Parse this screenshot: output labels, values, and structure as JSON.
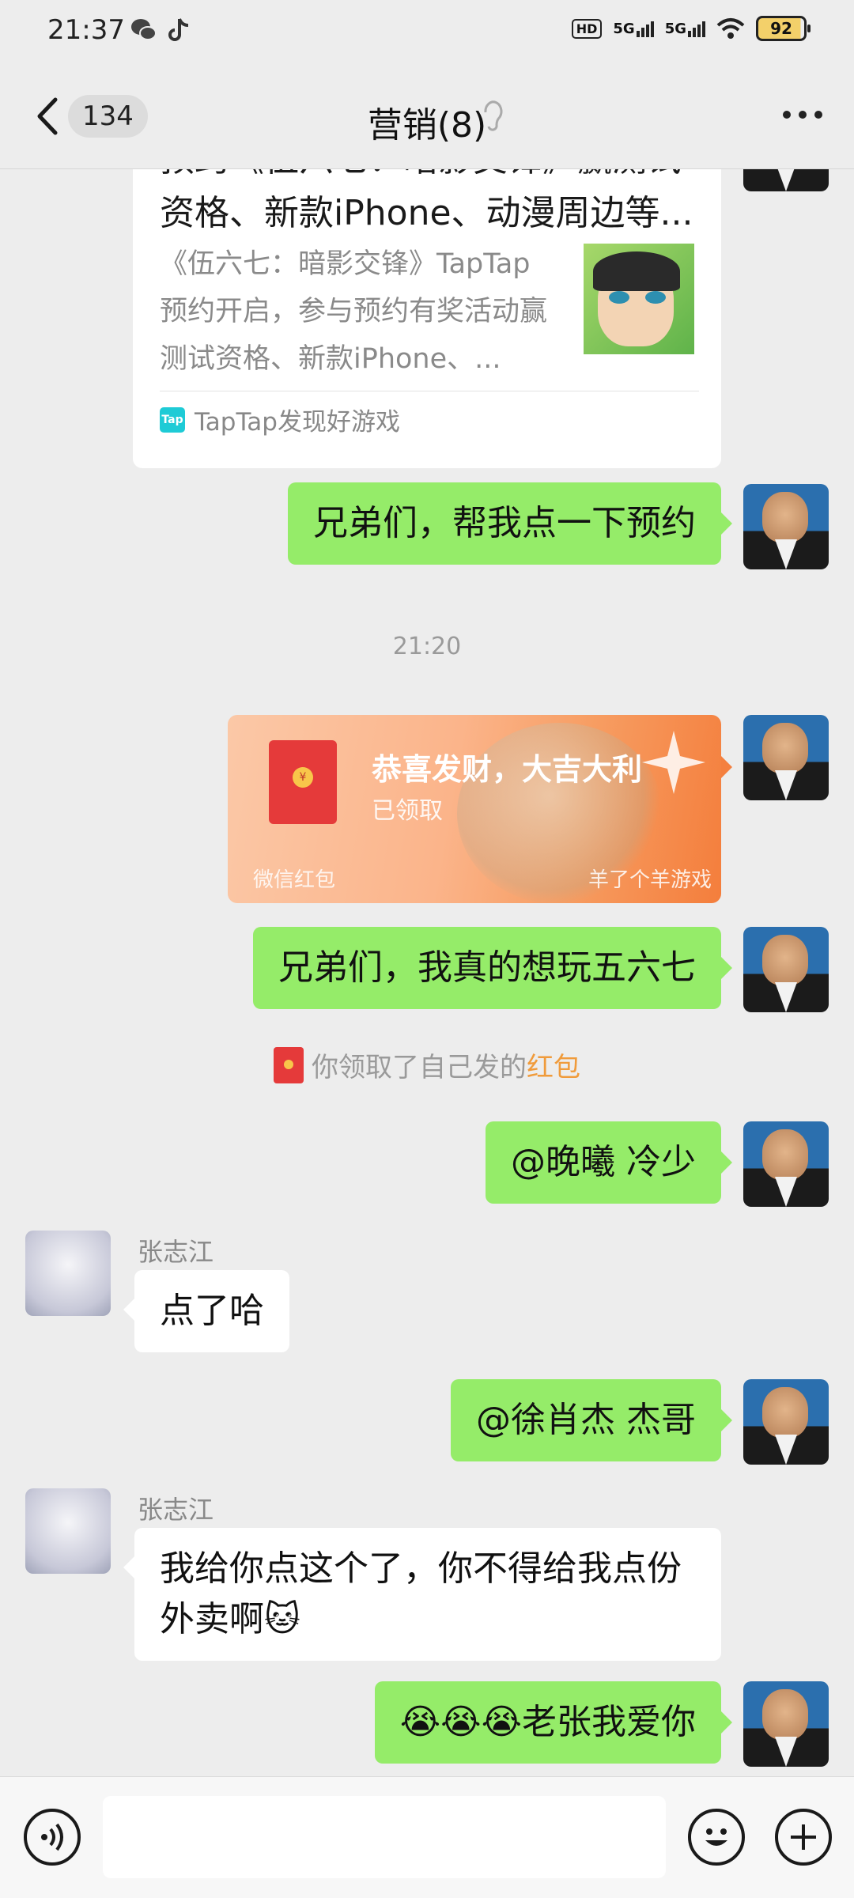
{
  "status_bar": {
    "time": "21:37",
    "hd_label": "HD",
    "net1": "5G",
    "net2": "5G",
    "battery": "92"
  },
  "header": {
    "unread_count": "134",
    "title": "营销(8)"
  },
  "link_card": {
    "title": "预约《伍六七：暗影交锋》赢测试资格、新款iPhone、动漫周边等...",
    "description": "《伍六七：暗影交锋》TapTap预约开启，参与预约有奖活动赢测试资格、新款iPhone、...",
    "source": "TapTap发现好游戏",
    "source_logo": "Tap"
  },
  "messages": {
    "m1": "兄弟们，帮我点一下预约",
    "timestamp": "21:20",
    "red_packet": {
      "title": "恭喜发财，大吉大利",
      "status": "已领取",
      "footer": "微信红包",
      "brand": "羊了个羊游戏",
      "coin": "¥"
    },
    "m2": "兄弟们，我真的想玩五六七",
    "system": {
      "prefix": "你领取了自己发的",
      "link": "红包"
    },
    "m3": "@晚曦  冷少",
    "sender1": "张志江",
    "r1": "点了哈",
    "m4": "@徐肖杰  杰哥",
    "sender2": "张志江",
    "r2": "我给你点这个了，你不得给我点份外卖啊🐱",
    "m5": "😭😭😭老张我爱你"
  },
  "icons": [
    "back-arrow-icon",
    "ear-icon",
    "more-icon",
    "voice-icon",
    "emoji-icon",
    "plus-icon",
    "wechat-icon",
    "tiktok-icon",
    "wifi-icon"
  ]
}
